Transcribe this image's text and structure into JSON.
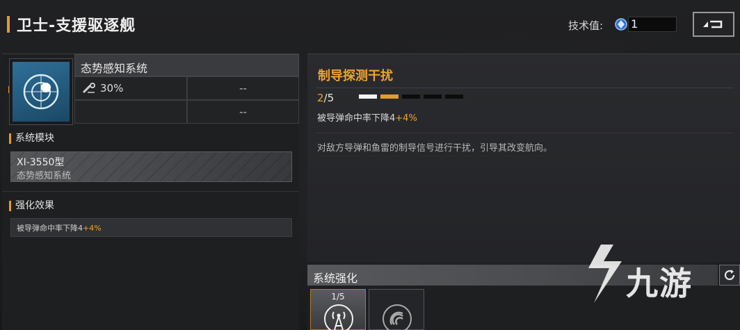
{
  "header": {
    "title": "卫士-支援驱逐舰",
    "tech_label": "技术值:",
    "tech_value": "1"
  },
  "module": {
    "name": "态势感知系统",
    "stat_value": "30%",
    "empty_1": "--",
    "empty_2": "--"
  },
  "sections": {
    "system_modules": "系统模块",
    "enhance_effects": "强化效果"
  },
  "module_card": {
    "model": "XI-3550型",
    "subtitle": "态势感知系统"
  },
  "effect": {
    "text": "被导弹命中率下降4",
    "bonus": "+4%"
  },
  "skill": {
    "name": "制导探测干扰",
    "level_current": "2",
    "level_max": "/5",
    "level_fraction": 0.4,
    "stat_text": "被导弹命中率下降4",
    "stat_bonus": "+4%",
    "description": "对敌方导弹和鱼雷的制导信号进行干扰，引导其改变航向。"
  },
  "enhance": {
    "title": "系统强化",
    "slot_1_label": "1/5"
  },
  "watermark": {
    "text": "九游"
  },
  "colors": {
    "accent": "#e89a2a",
    "accent_text": "#f0a32e",
    "icon_blue": "#2f6f98"
  },
  "icons": [
    "tech-gem-icon",
    "back-icon",
    "radar-icon",
    "wrench-icon",
    "refresh-icon",
    "signal-tower-icon",
    "sonar-icon",
    "jiuyou-logo-icon"
  ]
}
